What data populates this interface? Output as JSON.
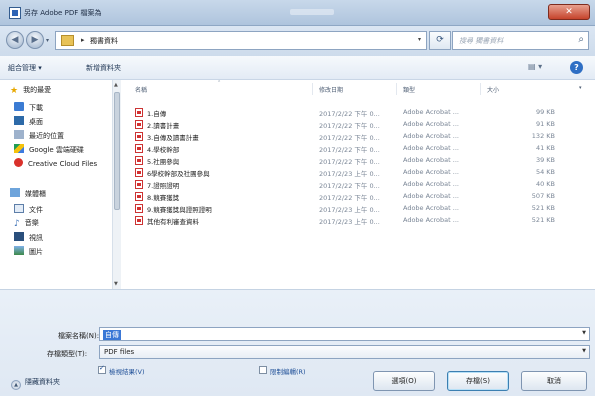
{
  "window": {
    "title": "另存 Adobe PDF 檔案為",
    "close_glyph": "✕"
  },
  "address": {
    "separator": "▸",
    "path": "獨書資料",
    "search_placeholder": "搜尋 獨書資料"
  },
  "toolbar": {
    "organize_label": "組合管理 ▾",
    "new_folder_label": "新增資料夾",
    "view_glyph": "▤ ▾",
    "help_glyph": "?"
  },
  "nav": {
    "favorites_header": "我的最愛",
    "favorites": [
      "下載",
      "桌面",
      "最近的位置",
      "Google 雲端硬碟",
      "Creative Cloud Files"
    ],
    "libraries_header": "媒體櫃",
    "libraries": [
      "文件",
      "音樂",
      "視訊",
      "圖片"
    ]
  },
  "columns": {
    "name": "名稱",
    "date": "修改日期",
    "type": "類型",
    "size": "大小"
  },
  "files": [
    {
      "name": "1.自傳",
      "date": "2017/2/22 下午 0...",
      "type": "Adobe Acrobat ...",
      "size": "99 KB"
    },
    {
      "name": "2.讀書計畫",
      "date": "2017/2/22 下午 0...",
      "type": "Adobe Acrobat ...",
      "size": "91 KB"
    },
    {
      "name": "3.自傳及讀書計畫",
      "date": "2017/2/22 下午 0...",
      "type": "Adobe Acrobat ...",
      "size": "132 KB"
    },
    {
      "name": "4.學校幹部",
      "date": "2017/2/22 下午 0...",
      "type": "Adobe Acrobat ...",
      "size": "41 KB"
    },
    {
      "name": "5.社團參與",
      "date": "2017/2/22 下午 0...",
      "type": "Adobe Acrobat ...",
      "size": "39 KB"
    },
    {
      "name": "6學校幹部及社團參與",
      "date": "2017/2/23 上午 0...",
      "type": "Adobe Acrobat ...",
      "size": "54 KB"
    },
    {
      "name": "7.證照證明",
      "date": "2017/2/22 下午 0...",
      "type": "Adobe Acrobat ...",
      "size": "40 KB"
    },
    {
      "name": "8.競賽獲獎",
      "date": "2017/2/22 下午 0...",
      "type": "Adobe Acrobat ...",
      "size": "507 KB"
    },
    {
      "name": "9.競賽獲獎與證照證明",
      "date": "2017/2/23 上午 0...",
      "type": "Adobe Acrobat ...",
      "size": "521 KB"
    },
    {
      "name": "其他有利審查資料",
      "date": "2017/2/23 上午 0...",
      "type": "Adobe Acrobat ...",
      "size": "521 KB"
    }
  ],
  "form": {
    "filename_label": "檔案名稱(N):",
    "filename_value": "自傳",
    "filetype_label": "存檔類型(T):",
    "filetype_value": "PDF files",
    "view_result_label": "檢視結果(V)",
    "security_label": "限制編輯(R)",
    "hide_folders_label": "隱藏資料夾"
  },
  "buttons": {
    "tools": "選項(O)",
    "save": "存檔(S)",
    "cancel": "取消"
  }
}
